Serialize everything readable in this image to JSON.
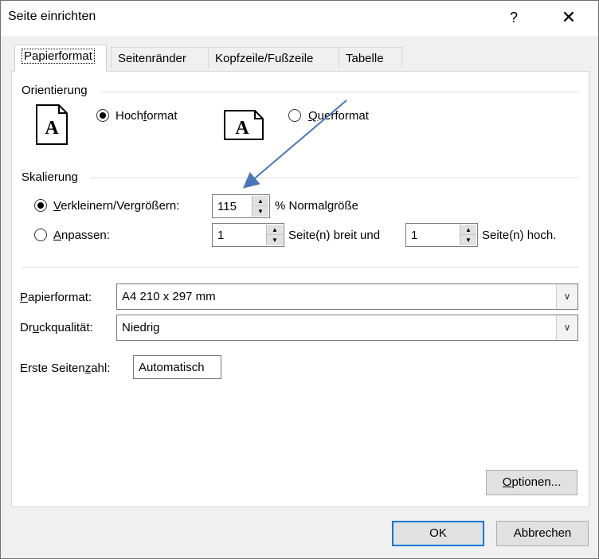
{
  "window": {
    "title": "Seite einrichten",
    "help_label": "?",
    "close_label": "✕"
  },
  "tabs": [
    {
      "label": "Papierformat",
      "active": true
    },
    {
      "label": "Seitenränder",
      "active": false
    },
    {
      "label": "Kopfzeile/Fußzeile",
      "active": false
    },
    {
      "label": "Tabelle",
      "active": false
    }
  ],
  "orientation": {
    "group_label": "Orientierung",
    "portrait": {
      "label_pre": "Hoch",
      "label_u": "f",
      "label_post": "ormat",
      "checked": true,
      "icon_letter": "A"
    },
    "landscape": {
      "label_pre": "",
      "label_u": "Q",
      "label_post": "uerformat",
      "checked": false,
      "icon_letter": "A"
    }
  },
  "scaling": {
    "group_label": "Skalierung",
    "adjust": {
      "label_u": "V",
      "label_post": "erkleinern/Vergrößern:",
      "checked": true,
      "value": "115",
      "suffix": "% Normalgröße"
    },
    "fit": {
      "label_u": "A",
      "label_post": "npassen:",
      "checked": false,
      "wide_value": "1",
      "wide_suffix": "Seite(n) breit und",
      "tall_value": "1",
      "tall_suffix": "Seite(n) hoch."
    }
  },
  "paper_size": {
    "label_u": "P",
    "label_post": "apierformat:",
    "value": "A4 210 x 297 mm"
  },
  "print_quality": {
    "label_pre": "Dr",
    "label_u": "u",
    "label_post": "ckqualität:",
    "value": "Niedrig"
  },
  "first_page": {
    "label_pre": "Erste Seiten",
    "label_u": "z",
    "label_post": "ahl:",
    "value": "Automatisch"
  },
  "buttons": {
    "options": {
      "label_u": "O",
      "label_post": "ptionen..."
    },
    "ok": "OK",
    "cancel": "Abbrechen"
  },
  "annotation": {
    "color": "#4a76b8",
    "type": "arrow"
  }
}
